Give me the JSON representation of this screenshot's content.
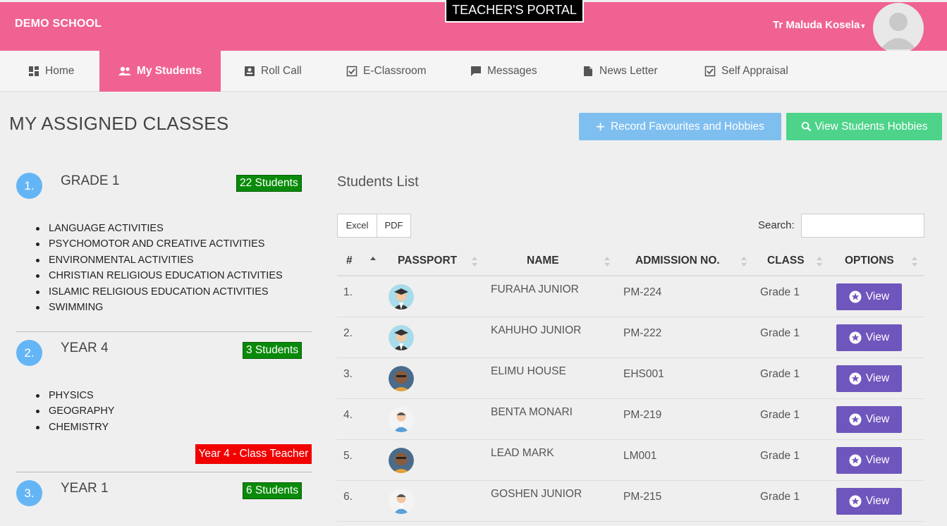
{
  "header": {
    "school": "DEMO SCHOOL",
    "portal": "TEACHER'S PORTAL",
    "user": "Tr Maluda Kosela"
  },
  "nav": [
    {
      "label": "Home",
      "icon": "dashboard-icon"
    },
    {
      "label": "My Students",
      "icon": "users-icon"
    },
    {
      "label": "Roll Call",
      "icon": "id-card-icon"
    },
    {
      "label": "E-Classroom",
      "icon": "check-square-icon"
    },
    {
      "label": "Messages",
      "icon": "message-icon"
    },
    {
      "label": "News Letter",
      "icon": "document-icon"
    },
    {
      "label": "Self Appraisal",
      "icon": "check-square-icon"
    }
  ],
  "page": {
    "title": "MY ASSIGNED CLASSES",
    "record_btn": "Record Favourites and Hobbies",
    "hobbies_btn": "View Students Hobbies"
  },
  "classes": [
    {
      "num": "1.",
      "name": "GRADE 1",
      "count": "22 Students",
      "subjects": [
        "LANGUAGE ACTIVITIES",
        "PSYCHOMOTOR AND CREATIVE ACTIVITIES",
        "ENVIRONMENTAL ACTIVITIES",
        "CHRISTIAN RELIGIOUS EDUCATION ACTIVITIES",
        "ISLAMIC RELIGIOUS EDUCATION ACTIVITIES",
        "SWIMMING"
      ]
    },
    {
      "num": "2.",
      "name": "YEAR 4",
      "count": "3 Students",
      "subjects": [
        "PHYSICS",
        "GEOGRAPHY",
        "CHEMISTRY"
      ],
      "badge": "Year 4 - Class Teacher"
    },
    {
      "num": "3.",
      "name": "YEAR 1",
      "count": "6 Students",
      "subjects": []
    }
  ],
  "students": {
    "title": "Students List",
    "excel": "Excel",
    "pdf": "PDF",
    "search_label": "Search:",
    "search_value": "",
    "columns": [
      "#",
      "PASSPORT",
      "NAME",
      "ADMISSION NO.",
      "CLASS",
      "OPTIONS"
    ],
    "rows": [
      {
        "no": "1.",
        "name": "FURAHA JUNIOR",
        "adm": "PM-224",
        "cls": "Grade 1",
        "avatar": "graduate-avatar"
      },
      {
        "no": "2.",
        "name": "KAHUHO JUNIOR",
        "adm": "PM-222",
        "cls": "Grade 1",
        "avatar": "graduate-avatar"
      },
      {
        "no": "3.",
        "name": "ELIMU HOUSE",
        "adm": "EHS001",
        "cls": "Grade 1",
        "avatar": "photo-avatar"
      },
      {
        "no": "4.",
        "name": "BENTA MONARI",
        "adm": "PM-219",
        "cls": "Grade 1",
        "avatar": "man-avatar"
      },
      {
        "no": "5.",
        "name": "LEAD MARK",
        "adm": "LM001",
        "cls": "Grade 1",
        "avatar": "photo-avatar"
      },
      {
        "no": "6.",
        "name": "GOSHEN JUNIOR",
        "adm": "PM-215",
        "cls": "Grade 1",
        "avatar": "man-avatar"
      }
    ],
    "view_label": "View"
  },
  "colors": {
    "brand": "#f06292",
    "count_badge": "#0a8a0a",
    "teacher_badge": "#f20000",
    "view_button": "#6f56bd",
    "record_button": "#7fbff0",
    "hobbies_button": "#4dd38a"
  }
}
